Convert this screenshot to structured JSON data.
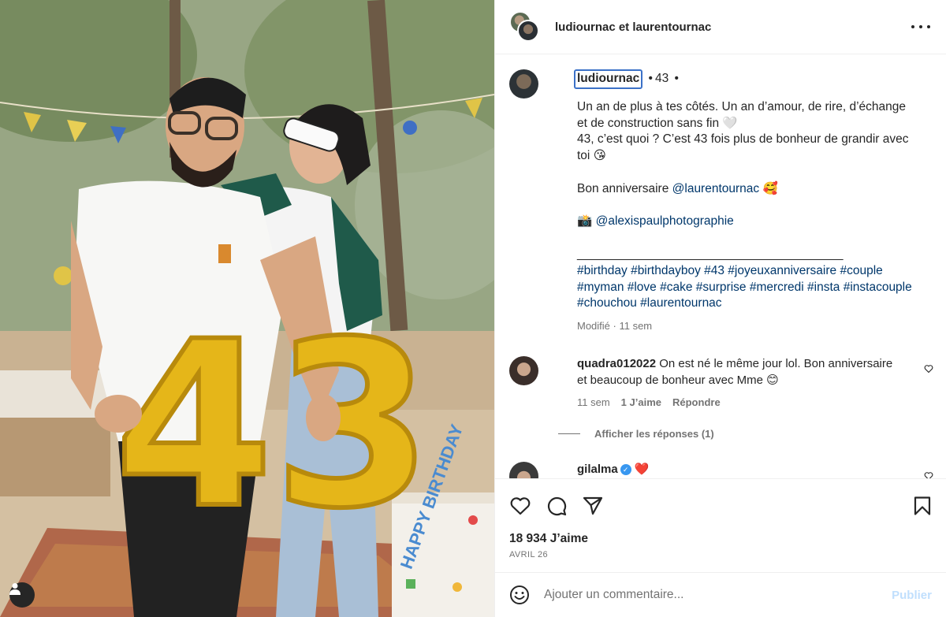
{
  "header": {
    "title": "ludiournac et laurentournac"
  },
  "caption": {
    "username": "ludiournac",
    "separator": "•",
    "number": "43",
    "lines": [
      "Un an de plus à tes côtés. Un an d’amour, de rire, d’échange",
      "et de construction sans fin 🤍",
      "43, c’est quoi ? C’est 43 fois plus de bonheur de grandir avec",
      "toi 😘"
    ],
    "birthday_prefix": "Bon anniversaire",
    "birthday_mention": "@laurentournac",
    "birthday_emoji": "🥰",
    "camera_emoji": "📸",
    "photo_credit": "@alexispaulphotographie",
    "divider": "__________________________________________",
    "hashtag_lines": [
      "#birthday #birthdayboy #43 #joyeuxanniversaire #couple",
      "#myman #love #cake #surprise #mercredi #insta #instacouple",
      "#chouchou #laurentournac"
    ],
    "modified": "Modifié · 11 sem"
  },
  "comments": [
    {
      "username": "quadra012022",
      "text_line1": "On est né le même jour lol. Bon anniversaire",
      "text_line2": "et beaucoup de bonheur avec Mme 😊",
      "time": "11 sem",
      "likes": "1 J’aime",
      "reply": "Répondre",
      "show_replies": "Afficher les réponses (1)"
    },
    {
      "username": "gilalma",
      "verified_mark": "✓",
      "text": "❤️"
    }
  ],
  "stats": {
    "likes": "18 934 J’aime",
    "date": "AVRIL 26"
  },
  "comment_box": {
    "emoji": "☺",
    "placeholder": "Ajouter un commentaire...",
    "publish": "Publier"
  },
  "photo": {
    "balloon_digits": "43",
    "gift_text": "HAPPY BIRTHDAY"
  },
  "icons": [
    "like-icon",
    "comment-icon",
    "share-icon",
    "save-icon",
    "more-icon",
    "user-tag-icon",
    "emoji-icon"
  ],
  "colors": {
    "link": "#00376b",
    "muted": "#737373",
    "publish_disabled": "#c0dffd",
    "verified": "#3897f0",
    "focus_ring": "#3b71c8"
  }
}
